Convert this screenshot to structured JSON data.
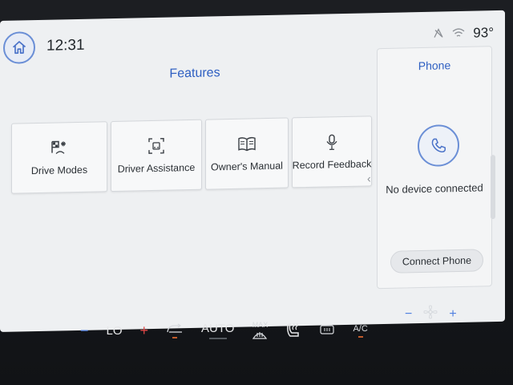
{
  "header": {
    "time": "12:31",
    "temperature": "93°"
  },
  "features": {
    "title": "Features",
    "tiles": [
      {
        "label": "Drive Modes",
        "icon": "drive-modes-icon"
      },
      {
        "label": "Driver Assistance",
        "icon": "driver-assistance-icon"
      },
      {
        "label": "Owner's Manual",
        "icon": "owners-manual-icon"
      },
      {
        "label": "Record Feedback",
        "icon": "microphone-icon"
      }
    ]
  },
  "phone": {
    "title": "Phone",
    "status": "No device connected",
    "connect_label": "Connect Phone"
  },
  "climate": {
    "temp_setting": "LO",
    "auto_label": "AUTO",
    "max_label": "MAX",
    "ac_label": "A/C"
  },
  "colors": {
    "accent_blue": "#2e5fc2",
    "icon_ring": "#6b8fd6",
    "heat_red": "#e04848",
    "cool_blue": "#4f7fe0"
  }
}
